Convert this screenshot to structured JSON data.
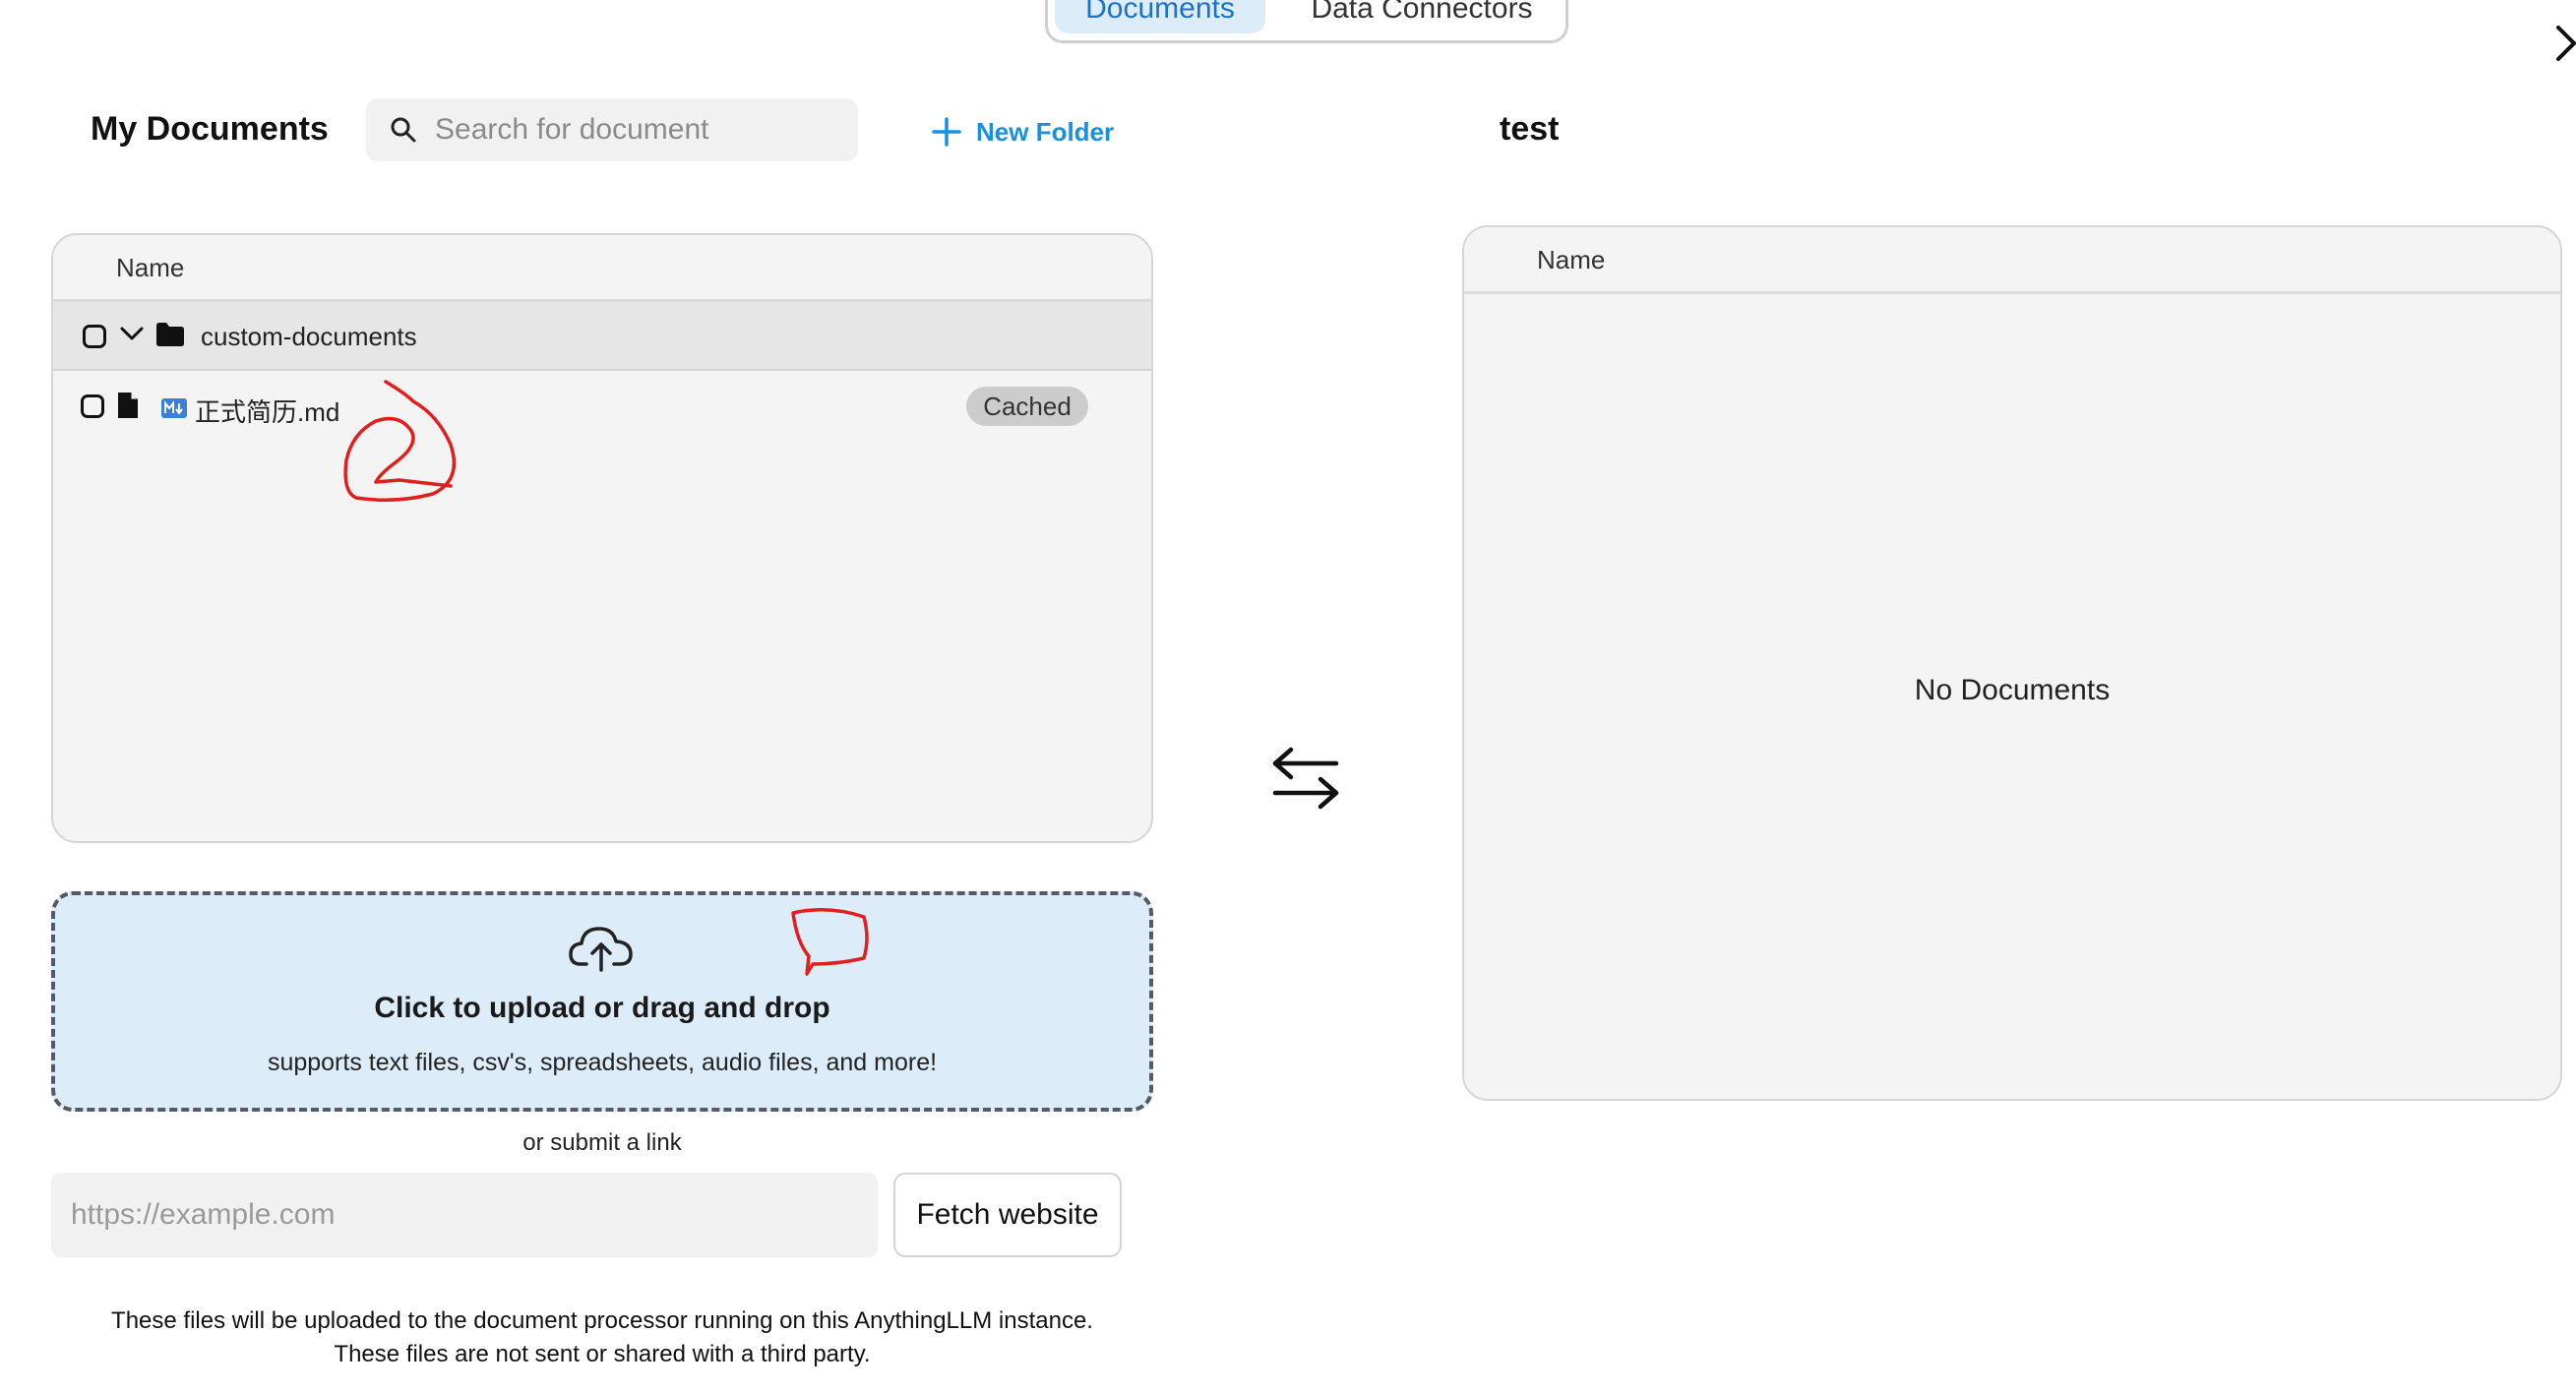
{
  "tabs": {
    "documents": "Documents",
    "data_connectors": "Data Connectors"
  },
  "left": {
    "title": "My Documents",
    "search_placeholder": "Search for document",
    "new_folder": "New Folder",
    "column_name": "Name",
    "folder": {
      "name": "custom-documents"
    },
    "file": {
      "name": "正式简历.md",
      "badge": "Cached"
    }
  },
  "right": {
    "title": "test",
    "column_name": "Name",
    "empty": "No Documents"
  },
  "upload": {
    "title": "Click to upload or drag and drop",
    "subtitle": "supports text files, csv's, spreadsheets, audio files, and more!",
    "or_link": "or submit a link",
    "url_placeholder": "https://example.com",
    "fetch_button": "Fetch website"
  },
  "footer": {
    "line1": "These files will be uploaded to the document processor running on this AnythingLLM instance.",
    "line2": "These files are not sent or shared with a third party."
  },
  "colors": {
    "accent": "#1a8fe0",
    "upload_bg": "#dcedf9",
    "annotation": "#e01f1f"
  },
  "icons": [
    "close-icon",
    "search-icon",
    "plus-icon",
    "chevron-down-icon",
    "folder-icon",
    "file-icon",
    "markdown-icon",
    "swap-arrows-icon",
    "cloud-upload-icon"
  ]
}
